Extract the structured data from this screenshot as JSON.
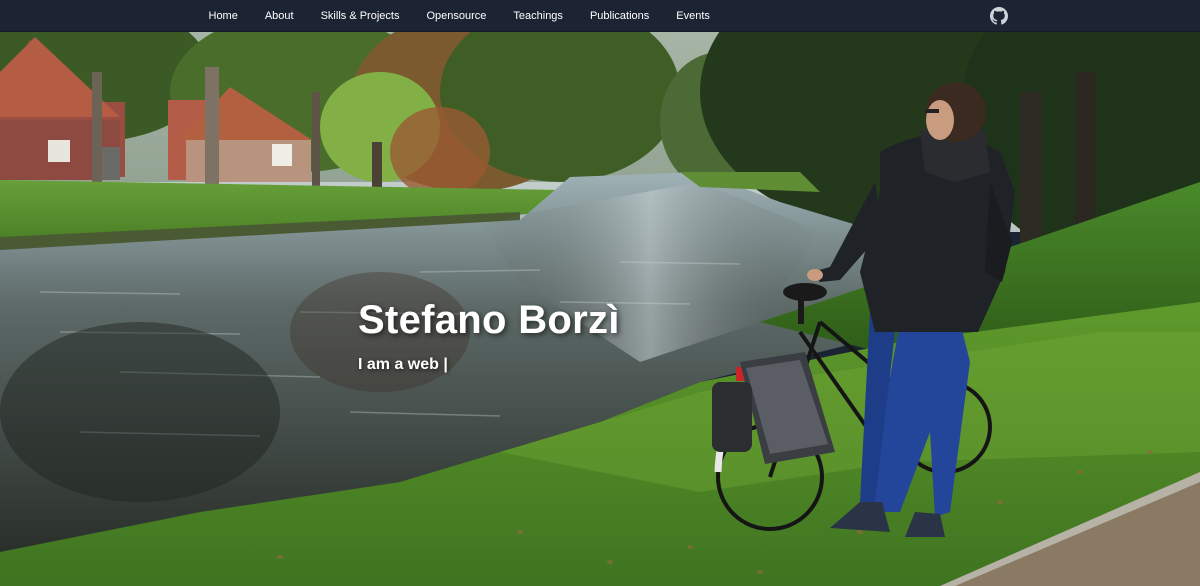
{
  "nav": {
    "items": [
      {
        "label": "Home"
      },
      {
        "label": "About"
      },
      {
        "label": "Skills & Projects"
      },
      {
        "label": "Opensource"
      },
      {
        "label": "Teachings"
      },
      {
        "label": "Publications"
      },
      {
        "label": "Events"
      }
    ],
    "github_icon": "github-icon"
  },
  "hero": {
    "title": "Stefano Borzì",
    "subtitle": "I am a web |",
    "background_image": "hero-background-photo"
  },
  "colors": {
    "navbar_bg": "#1c2433",
    "nav_text": "#ffffff",
    "hero_text": "#ffffff"
  }
}
